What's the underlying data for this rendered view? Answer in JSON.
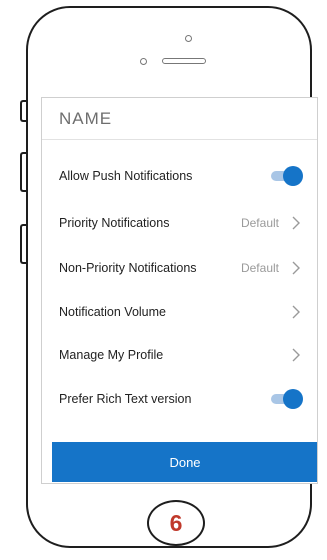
{
  "screen": {
    "title": "NAME",
    "rows": [
      {
        "label": "Allow Push Notifications",
        "control": "toggle",
        "on": true
      },
      {
        "label": "Priority Notifications",
        "value": "Default",
        "control": "chevron"
      },
      {
        "label": "Non-Priority Notifications",
        "value": "Default",
        "control": "chevron"
      },
      {
        "label": "Notification Volume",
        "control": "chevron"
      },
      {
        "label": "Manage My Profile",
        "control": "chevron"
      },
      {
        "label": "Prefer Rich Text version",
        "control": "toggle",
        "on": true
      }
    ],
    "done_label": "Done"
  },
  "step_number": "6",
  "colors": {
    "accent": "#1574c8",
    "toggle_track": "#a9c6e6",
    "step_number": "#c0392b"
  }
}
